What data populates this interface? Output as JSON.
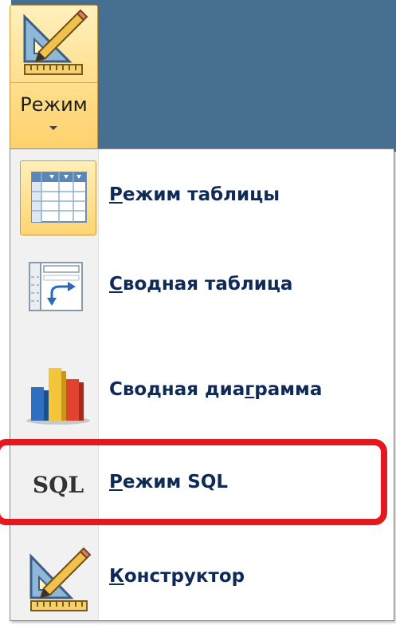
{
  "ribbon": {
    "mode_button": {
      "label": "Режим",
      "icon": "design-view-icon"
    }
  },
  "menu": {
    "items": [
      {
        "label_hotkey": "Р",
        "label_rest": "ежим таблицы",
        "icon": "datasheet-view-icon",
        "selected": true
      },
      {
        "label_hotkey": "С",
        "label_rest": "водная таблица",
        "icon": "pivot-table-icon"
      },
      {
        "label_before": "Сводная диа",
        "label_hotkey": "г",
        "label_after": "рамма",
        "icon": "pivot-chart-icon"
      },
      {
        "label_hotkey": "Р",
        "label_rest": "ежим SQL",
        "icon_text": "SQL",
        "icon": "sql-view-icon",
        "highlighted": true
      },
      {
        "label_hotkey": "К",
        "label_rest": "онструктор",
        "icon": "design-view-icon"
      }
    ]
  },
  "colors": {
    "ribbon": "#466f91",
    "selected": "#ffd473",
    "highlight": "#e4181d",
    "label": "#0f2a57"
  }
}
